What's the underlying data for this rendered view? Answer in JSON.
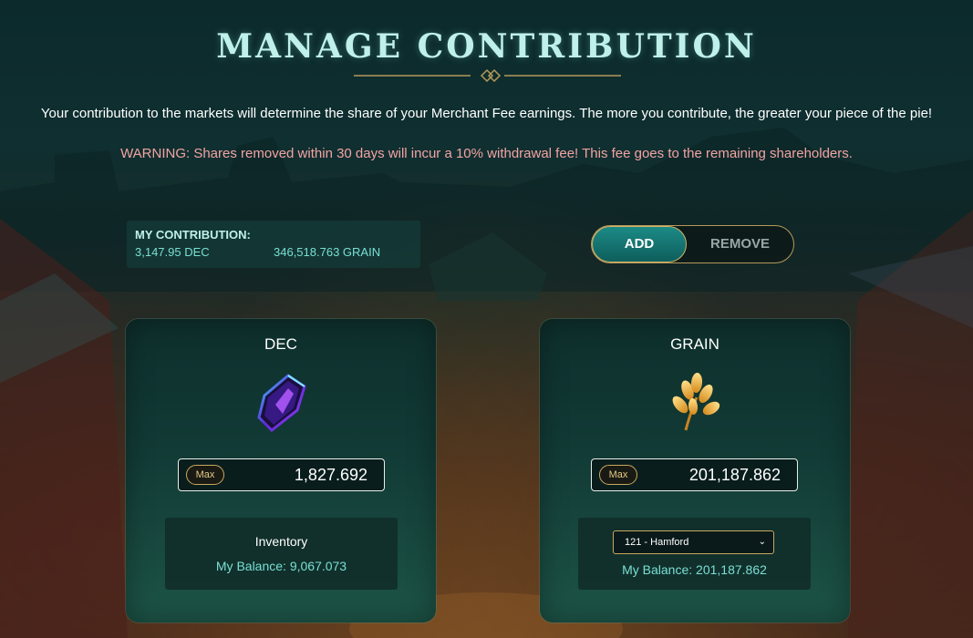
{
  "header": {
    "title": "MANAGE CONTRIBUTION",
    "intro": "Your contribution to the markets will determine the share of your Merchant Fee earnings. The more you contribute, the greater your piece of the pie!",
    "warning": "WARNING: Shares removed within 30 days will incur a 10% withdrawal fee! This fee goes to the remaining shareholders."
  },
  "contribution": {
    "label": "MY CONTRIBUTION:",
    "dec": "3,147.95 DEC",
    "grain": "346,518.763 GRAIN"
  },
  "toggle": {
    "add_label": "ADD",
    "remove_label": "REMOVE",
    "active": "ADD"
  },
  "dec_card": {
    "title": "DEC",
    "icon": "dec-crystal-icon",
    "max_label": "Max",
    "amount": "1,827.692",
    "panel_label": "Inventory",
    "balance": "My Balance: 9,067.073"
  },
  "grain_card": {
    "title": "GRAIN",
    "icon": "wheat-icon",
    "max_label": "Max",
    "amount": "201,187.862",
    "select_value": "121 - Hamford",
    "balance": "My Balance: 201,187.862"
  },
  "colors": {
    "title": "#bff0ea",
    "accent_teal": "#79e0d4",
    "warning": "#f3a3a3",
    "gold_border": "#c9a85e"
  }
}
